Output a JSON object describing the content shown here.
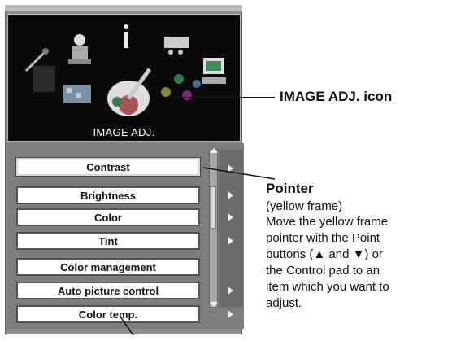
{
  "icon_panel": {
    "label": "IMAGE ADJ.",
    "icons": [
      "wrench-icon",
      "person-icon",
      "info-icon",
      "screen-icon",
      "monitor-icon",
      "checker-icon",
      "palette-icon",
      "balls-icon",
      "square-icon"
    ]
  },
  "menu": {
    "items": [
      {
        "label": "Contrast",
        "selected": true,
        "arrow": true
      },
      {
        "label": "Brightness",
        "selected": false,
        "arrow": true
      },
      {
        "label": "Color",
        "selected": false,
        "arrow": true
      },
      {
        "label": "Tint",
        "selected": false,
        "arrow": true
      },
      {
        "label": "Color management",
        "selected": false,
        "arrow": false
      },
      {
        "label": "Auto picture control",
        "selected": false,
        "arrow": true
      },
      {
        "label": "Color temp.",
        "selected": false,
        "arrow": true
      }
    ]
  },
  "callouts": {
    "image_adj": {
      "title": "IMAGE ADJ. icon"
    },
    "pointer": {
      "title": "Pointer",
      "subtitle": "(yellow frame)",
      "description_lines": [
        "Move the yellow frame",
        "pointer with the Point",
        "buttons (▲ and ▼) or",
        "the Control pad to an",
        "item which you want to",
        "adjust."
      ]
    }
  },
  "colors": {
    "panel_bg": "#0a0a0a",
    "frame": "#8e8e8e",
    "pointer": "#d8d8d8"
  }
}
